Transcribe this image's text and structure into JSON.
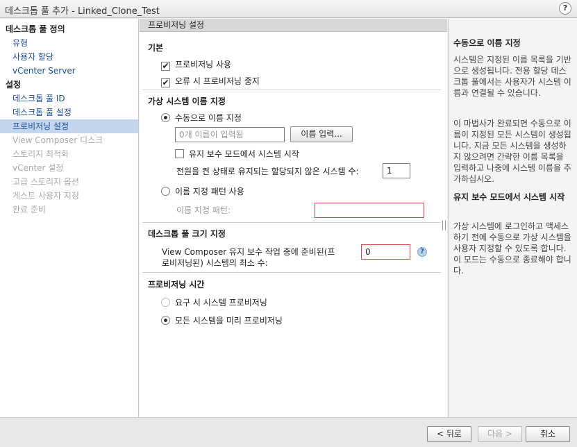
{
  "window": {
    "title": "데스크톱 풀 추가 - Linked_Clone_Test",
    "help_label": "?"
  },
  "sidebar": {
    "sections": [
      {
        "label": "데스크톱 풀 정의",
        "kind": "head"
      },
      {
        "label": "유형",
        "kind": "link"
      },
      {
        "label": "사용자 할당",
        "kind": "link"
      },
      {
        "label": "vCenter Server",
        "kind": "link"
      },
      {
        "label": "설정",
        "kind": "head"
      },
      {
        "label": "데스크톱 풀 ID",
        "kind": "link"
      },
      {
        "label": "데스크톱 풀 설정",
        "kind": "link"
      },
      {
        "label": "프로비저닝 설정",
        "kind": "active"
      },
      {
        "label": "View Composer 디스크",
        "kind": "disabled"
      },
      {
        "label": "스토리지 최적화",
        "kind": "disabled"
      },
      {
        "label": "vCenter 설정",
        "kind": "disabled"
      },
      {
        "label": "고급 스토리지 옵션",
        "kind": "disabled"
      },
      {
        "label": "게스트 사용자 지정",
        "kind": "disabled"
      },
      {
        "label": "완료 준비",
        "kind": "disabled"
      }
    ]
  },
  "main": {
    "header": "프로비저닝 설정",
    "basic": {
      "title": "기본",
      "enable_provisioning": {
        "label": "프로비저닝 사용",
        "checked": true,
        "mark": "✔"
      },
      "stop_on_error": {
        "label": "오류 시 프로비저닝 중지",
        "checked": true,
        "mark": "✔"
      }
    },
    "naming": {
      "title": "가상 시스템 이름 지정",
      "manual": {
        "label": "수동으로 이름 지정",
        "selected": true
      },
      "names_field_placeholder": "0개 이름이 입력됨",
      "enter_names_button": "이름 입력...",
      "maintenance_mode": {
        "label": "유지 보수 모드에서 시스템 시작",
        "checked": false
      },
      "unassigned_powered_on": {
        "label": "전원을 켠 상태로 유지되는 할당되지 않은 시스템 수:",
        "value": "1"
      },
      "pattern": {
        "label": "이름 지정 패턴 사용",
        "selected": false
      },
      "pattern_field_label": "이름 지정 패턴:",
      "pattern_field_value": ""
    },
    "sizing": {
      "title": "데스크톱 풀 크기 지정",
      "min_ready_label_1": "View Composer 유지 보수 작업 중에 준비된(프",
      "min_ready_label_2": "로비저닝된) 시스템의 최소 수:",
      "min_ready_value": "0",
      "help_icon": "?"
    },
    "timing": {
      "title": "프로비저닝 시간",
      "on_demand": {
        "label": "요구 시 시스템 프로비저닝",
        "selected": false
      },
      "up_front": {
        "label": "모든 시스템을 미리 프로비저닝",
        "selected": true
      }
    }
  },
  "help_panel": {
    "heading1": "수동으로 이름 지정",
    "para1": "시스템은 지정된 이름 목록을 기반으로 생성됩니다. 전용 할당 데스크톱 풀에서는 사용자가 시스템 이름과 연결될 수 있습니다.",
    "para2": "이 마법사가 완료되면 수동으로 이름이 지정된 모든 시스템이 생성됩니다. 지금 모든 시스템을 생성하지 않으려면 간략한 이름 목록을 입력하고 나중에 시스템 이름을 추가하십시오.",
    "heading2": "유지 보수 모드에서 시스템 시작",
    "para3": "가상 시스템에 로그인하고 액세스하기 전에 수동으로 가상 시스템을 사용자 지정할 수 있도록 합니다. 이 모드는 수동으로 종료해야 합니다."
  },
  "footer": {
    "back": "< 뒤로",
    "next": "다음 >",
    "cancel": "취소"
  }
}
